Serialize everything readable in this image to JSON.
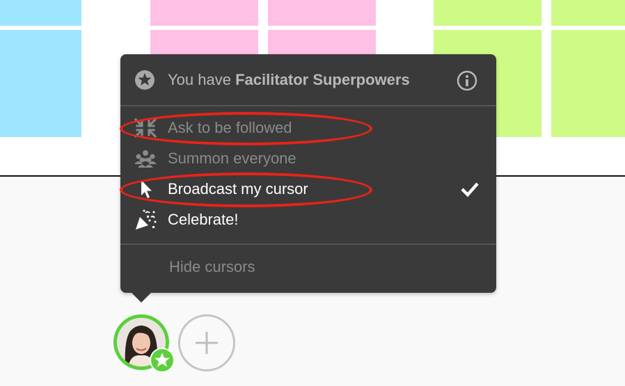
{
  "popup": {
    "header": {
      "prefix": "You have",
      "bold": "Facilitator Superpowers",
      "star_icon": "star-circle-icon",
      "info_icon": "info-icon"
    },
    "items": [
      {
        "label": "Ask to be followed",
        "icon": "collapse-arrows-icon",
        "enabled": false,
        "highlighted": true
      },
      {
        "label": "Summon everyone",
        "icon": "group-icon",
        "enabled": false,
        "highlighted": false
      },
      {
        "label": "Broadcast my cursor",
        "icon": "cursor-arrow-icon",
        "enabled": true,
        "checked": true,
        "highlighted": true
      },
      {
        "label": "Celebrate!",
        "icon": "party-popper-icon",
        "enabled": true,
        "highlighted": false
      }
    ],
    "footer": {
      "label": "Hide cursors"
    }
  },
  "participants": {
    "avatar_icon": "user-avatar",
    "badge_icon": "star-icon",
    "add_icon": "plus-icon"
  },
  "colors": {
    "popup_bg": "#3a3a3a",
    "highlight": "#e8231a",
    "sticky_blue": "#9ee6ff",
    "sticky_pink": "#ffc0e6",
    "sticky_green": "#cdfb86",
    "avatar_ring": "#5bd03a"
  }
}
